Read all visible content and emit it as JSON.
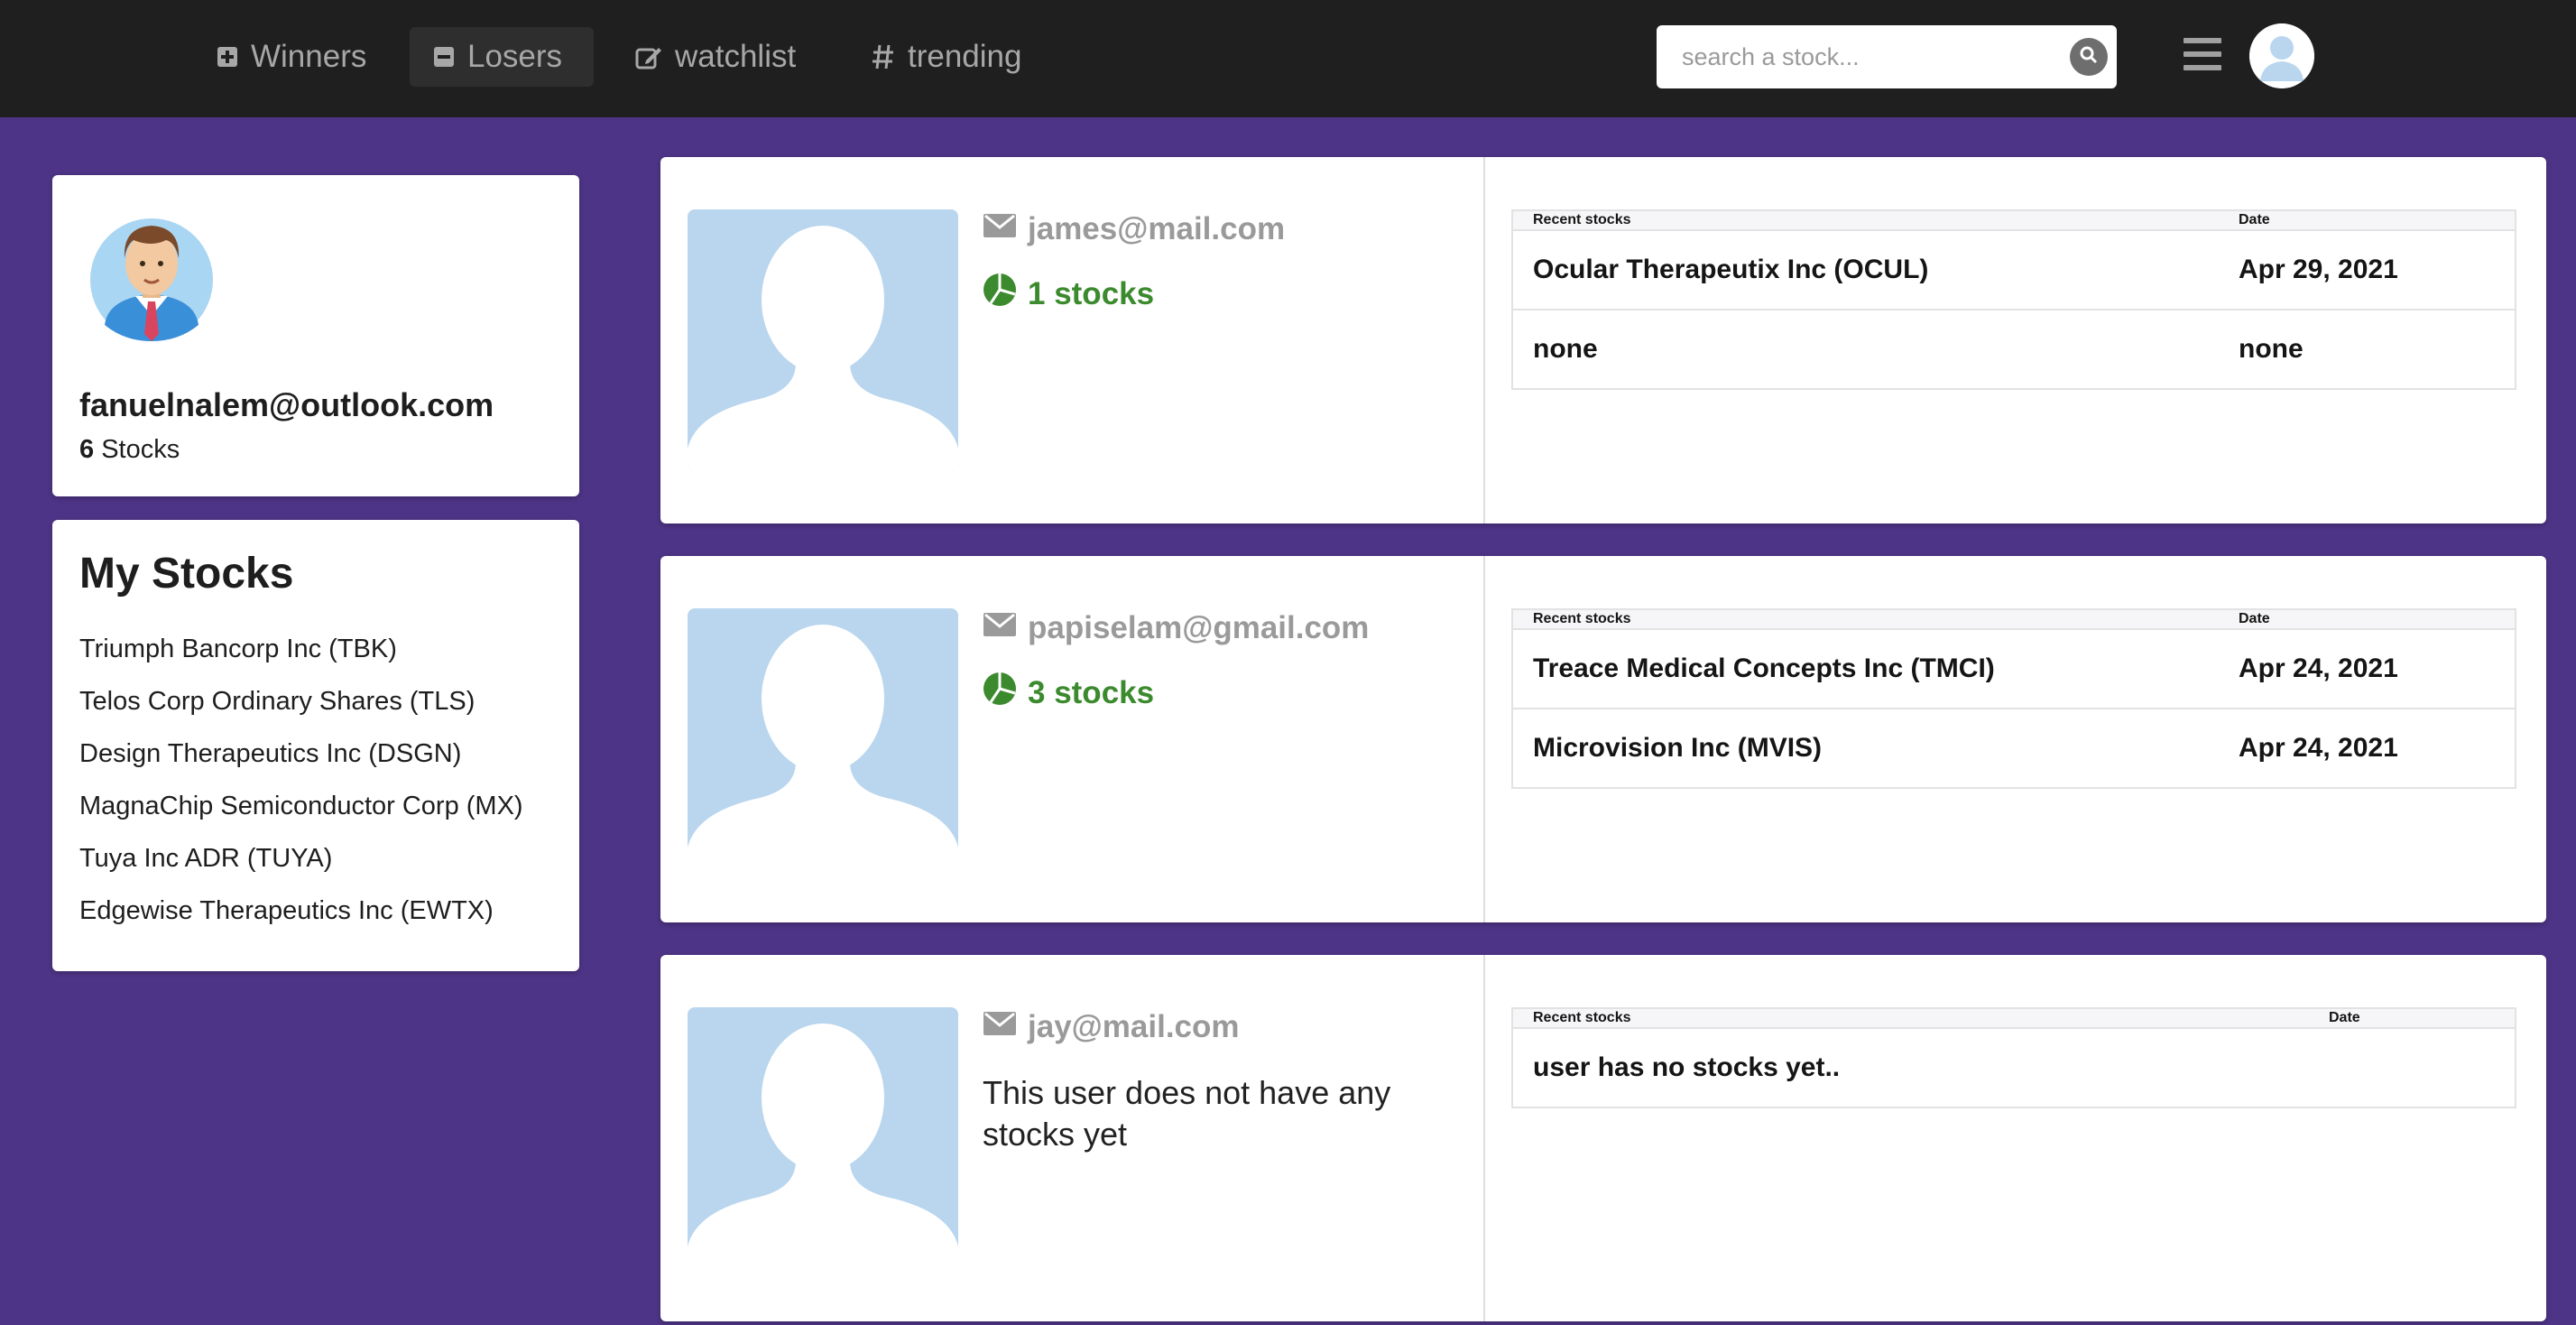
{
  "nav": {
    "items": [
      {
        "label": "Winners",
        "icon": "plus-square-icon"
      },
      {
        "label": "Losers",
        "icon": "minus-square-icon"
      },
      {
        "label": "watchlist",
        "icon": "edit-icon"
      },
      {
        "label": "trending",
        "icon": "hash-icon"
      }
    ],
    "active_item": "Losers",
    "search_placeholder": "search a stock...",
    "colors": {
      "bar": "#1f1f1f",
      "text": "#a7a7a7"
    }
  },
  "profile": {
    "email": "fanuelnalem@outlook.com",
    "stock_count": "6",
    "stock_count_suffix": " Stocks"
  },
  "my_stocks": {
    "title": "My Stocks",
    "items": [
      "Triumph Bancorp Inc (TBK)",
      "Telos Corp Ordinary Shares (TLS)",
      "Design Therapeutics Inc (DSGN)",
      "MagnaChip Semiconductor Corp (MX)",
      "Tuya Inc ADR (TUYA)",
      "Edgewise Therapeutics Inc (EWTX)"
    ]
  },
  "users": [
    {
      "email": "james@mail.com",
      "stocks_label": "1 stocks",
      "table": {
        "headers": [
          "Recent stocks",
          "Date"
        ],
        "rows": [
          [
            "Ocular Therapeutix Inc (OCUL)",
            "Apr 29, 2021"
          ],
          [
            "none",
            "none"
          ]
        ]
      }
    },
    {
      "email": "papiselam@gmail.com",
      "stocks_label": "3 stocks",
      "table": {
        "headers": [
          "Recent stocks",
          "Date"
        ],
        "rows": [
          [
            "Treace Medical Concepts Inc (TMCI)",
            "Apr 24, 2021"
          ],
          [
            "Microvision Inc (MVIS)",
            "Apr 24, 2021"
          ]
        ]
      }
    },
    {
      "email": "jay@mail.com",
      "no_stocks_message": "This user does not have any stocks yet",
      "table": {
        "headers": [
          "Recent stocks",
          "Date"
        ],
        "rows": [
          [
            "user has no stocks yet..",
            ""
          ]
        ]
      }
    }
  ],
  "colors": {
    "page_background": "#4e3486",
    "stocks_count_green": "#3c8a2e",
    "silhouette_blue": "#b9d6ee"
  }
}
